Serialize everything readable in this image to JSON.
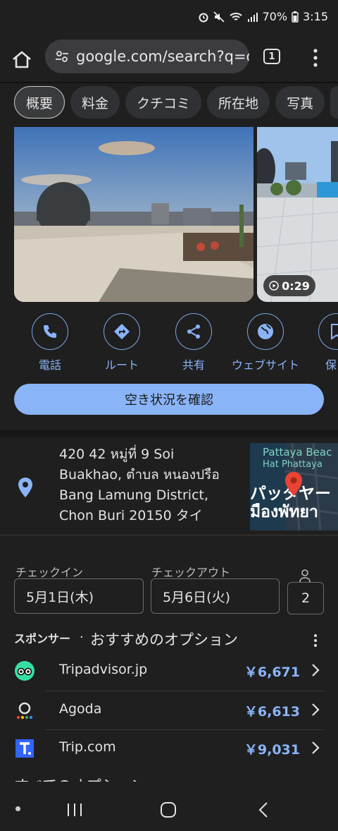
{
  "status": {
    "battery": "70%",
    "time": "3:15"
  },
  "browser": {
    "url": "google.com/search?q=de",
    "tab_count": "1"
  },
  "chips": [
    "概要",
    "料金",
    "クチコミ",
    "所在地",
    "写真"
  ],
  "photos": {
    "video_duration": "0:29"
  },
  "actions": [
    {
      "label": "電話",
      "icon": "phone-icon"
    },
    {
      "label": "ルート",
      "icon": "directions-icon"
    },
    {
      "label": "共有",
      "icon": "share-icon"
    },
    {
      "label": "ウェブサイト",
      "icon": "globe-icon"
    },
    {
      "label": "保",
      "icon": "bookmark-icon"
    }
  ],
  "cta": {
    "label": "空き状況を確認"
  },
  "address": {
    "lines": [
      "420 42 หมู่ที่ 9 Soi",
      "Buakhao, ตำบล หนองปรือ",
      "Bang Lamung District,",
      "Chon Buri 20150 タイ"
    ]
  },
  "map": {
    "label1": "Pattaya Beac",
    "label2": "Hat Phattaya",
    "label3": "パッタヤー",
    "label4": "มืองพัทยา"
  },
  "booking": {
    "checkin_label": "チェックイン",
    "checkout_label": "チェックアウト",
    "checkin_value": "5月1日(木)",
    "checkout_value": "5月6日(火)",
    "guests": "2"
  },
  "options": {
    "sponsor_label": "スポンサー",
    "dot": "·",
    "title": "おすすめのオプション",
    "items": [
      {
        "name": "Tripadvisor.jp",
        "price": "￥6,671"
      },
      {
        "name": "Agoda",
        "price": "￥6,613"
      },
      {
        "name": "Trip.com",
        "price": "￥9,031"
      }
    ],
    "all_options": "すべてのオプション"
  },
  "colors": {
    "accent": "#8ab4f8",
    "background": "#1f1f1f",
    "tripadvisor": "#34e0a1",
    "trip": "#3264ff"
  }
}
